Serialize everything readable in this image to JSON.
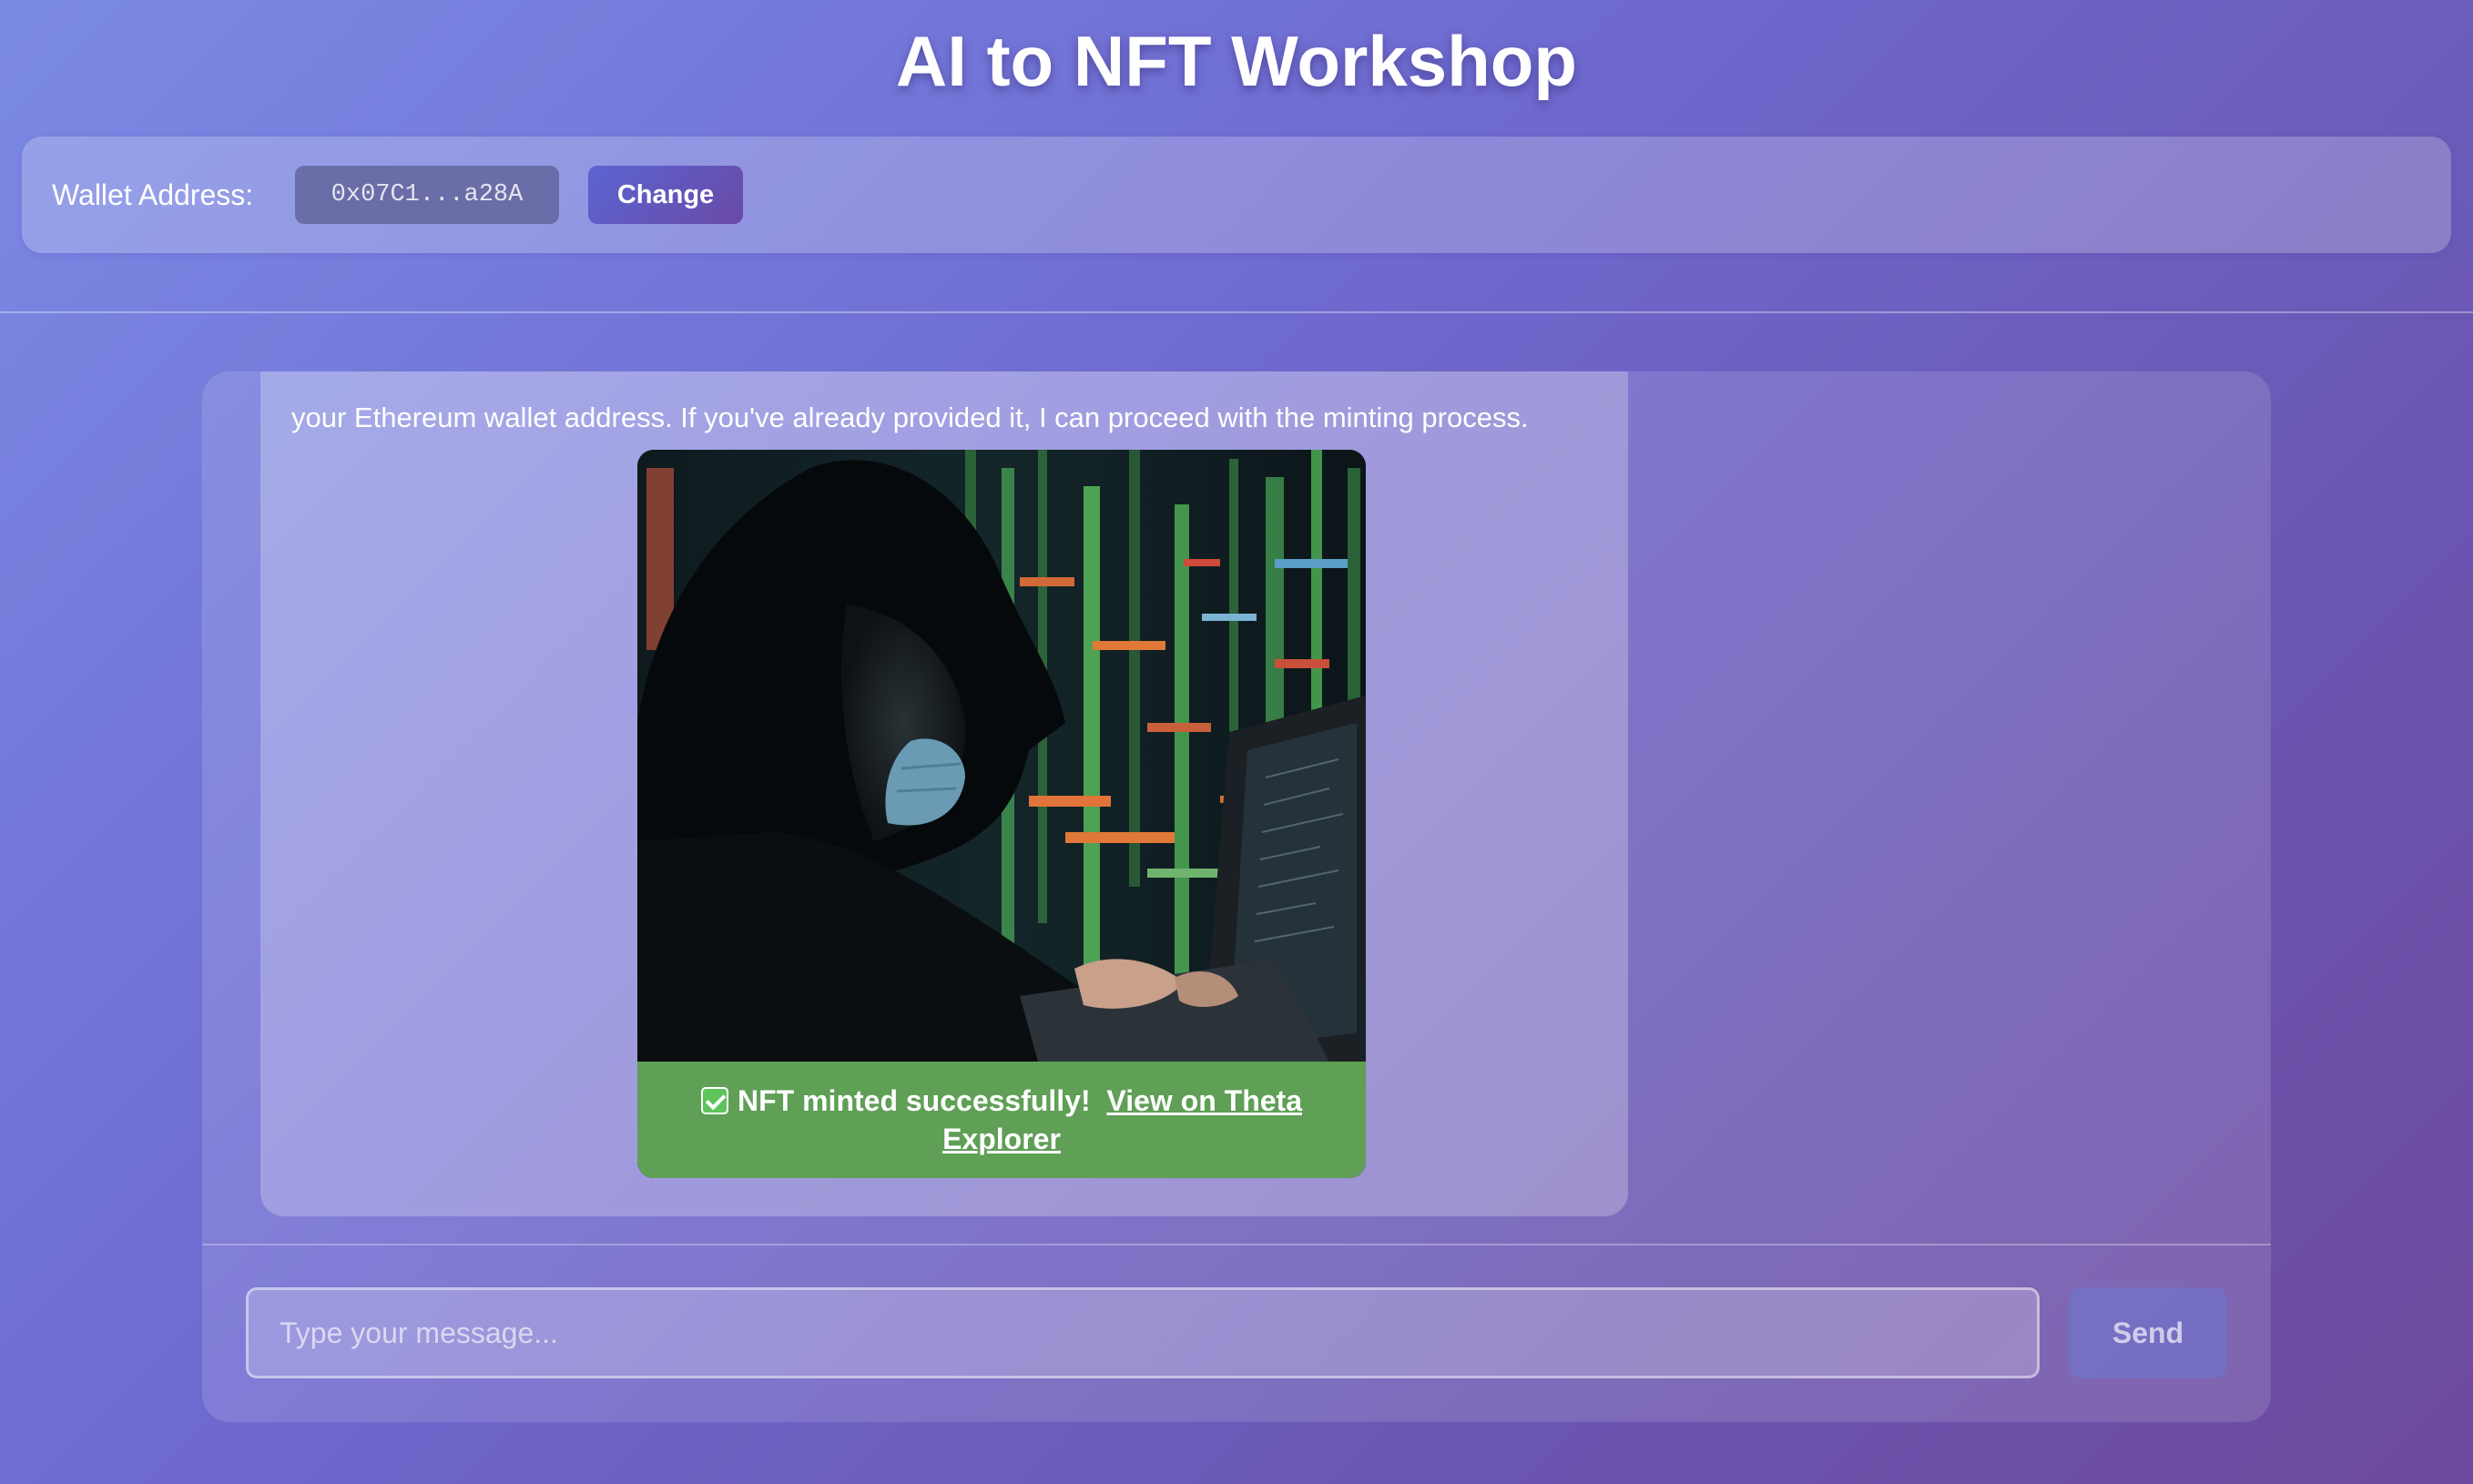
{
  "header": {
    "title": "AI to NFT Workshop"
  },
  "wallet": {
    "label": "Wallet Address:",
    "address": "0x07C1...a28A",
    "change_label": "Change"
  },
  "chat": {
    "messages": [
      {
        "role": "bot",
        "text": "your Ethereum wallet address. If you've already provided it, I can proceed with the minting process.",
        "nft": {
          "image_subject": "hooded hacker with face mask typing on laptop in front of code screens",
          "status_text": "NFT minted successfully!",
          "status_icon": "check-mark-icon",
          "link_text": "View on Theta Explorer",
          "status_color": "#5f9f56"
        }
      }
    ],
    "input": {
      "placeholder": "Type your message...",
      "value": ""
    },
    "send_label": "Send"
  },
  "colors": {
    "background_start": "#7a8ae4",
    "background_end": "#6e4a9e",
    "accent": "#5b64d2"
  }
}
